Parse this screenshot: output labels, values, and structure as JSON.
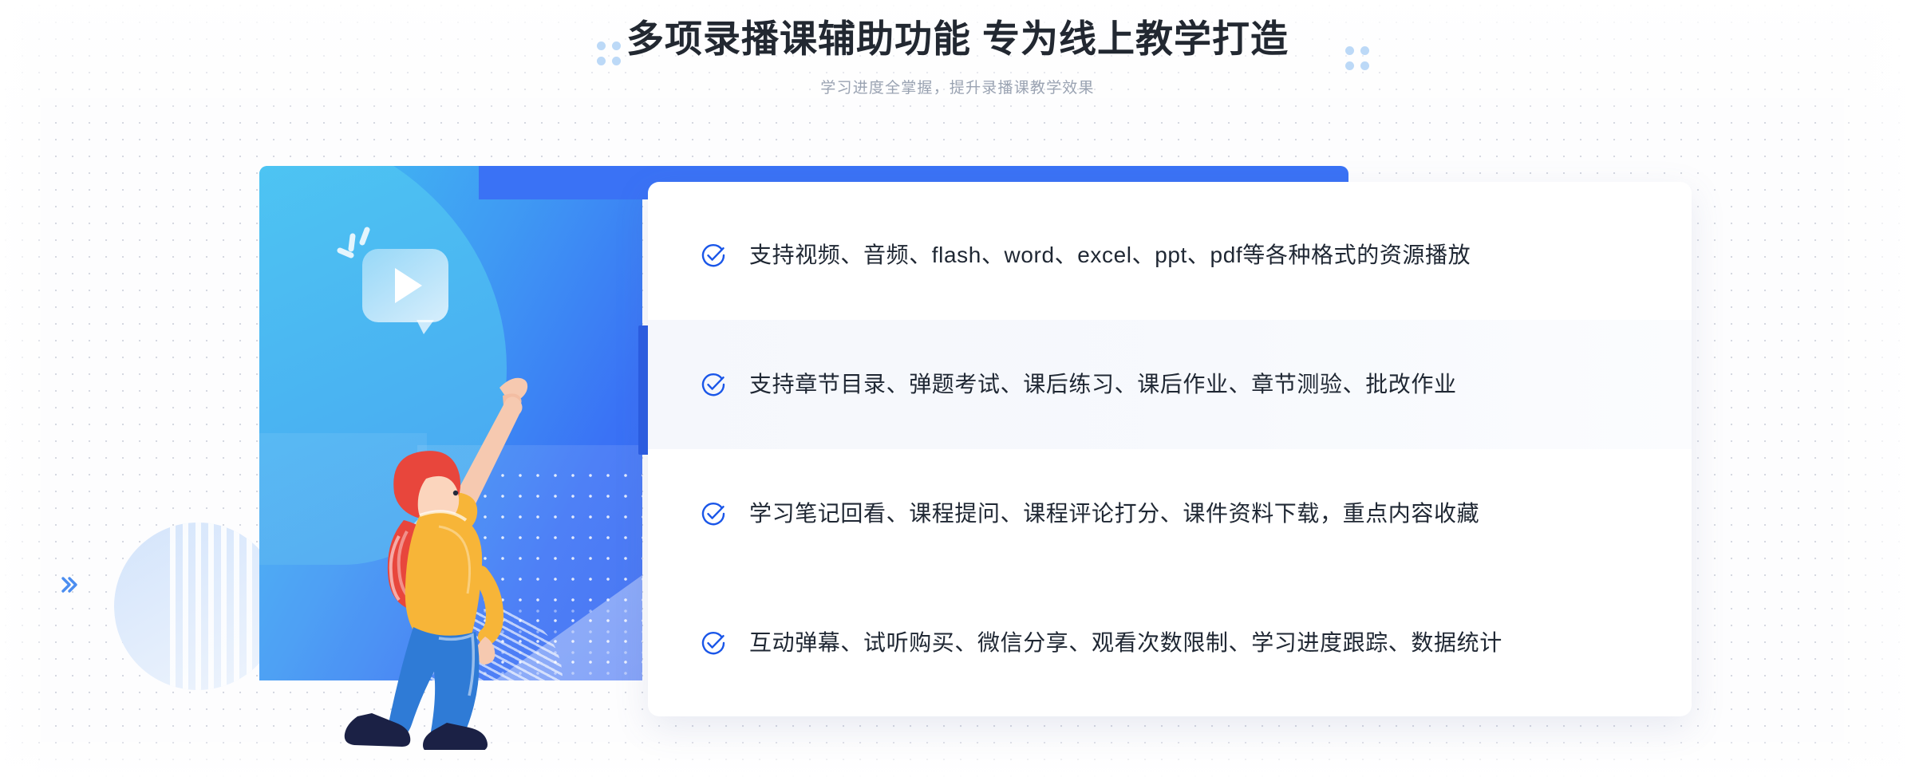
{
  "header": {
    "title": "多项录播课辅助功能 专为线上教学打造",
    "subtitle": "学习进度全掌握，提升录播课教学效果"
  },
  "illustration": {
    "play_bubble_icon": "play-button-speech-bubble",
    "character_alt": "woman-pointing-up-illustration",
    "chevron_right_icon": "chevron-double-right-icon",
    "chevron_left_icon": "chevron-double-left-icon",
    "panel_gradient_from": "#41c3f2",
    "panel_gradient_to": "#3566f2",
    "accent_bar_color": "#3a72f5",
    "accent_strip_color": "#2a5ce2"
  },
  "features": {
    "check_icon": "circle-check-icon",
    "items": [
      {
        "label": "支持视频、音频、flash、word、excel、ppt、pdf等各种格式的资源播放",
        "active": false
      },
      {
        "label": "支持章节目录、弹题考试、课后练习、课后作业、章节测验、批改作业",
        "active": true
      },
      {
        "label": "学习笔记回看、课程提问、课程评论打分、课件资料下载，重点内容收藏",
        "active": false
      },
      {
        "label": "互动弹幕、试听购买、微信分享、观看次数限制、学习进度跟踪、数据统计",
        "active": false
      }
    ]
  },
  "theme": {
    "accent": "#2a5ce2",
    "title_color": "#222831",
    "subtitle_color": "#9aa3b2",
    "text_color": "#1f2733",
    "row_highlight": "#f6f8fc",
    "dot_color": "#bcd9f7"
  }
}
